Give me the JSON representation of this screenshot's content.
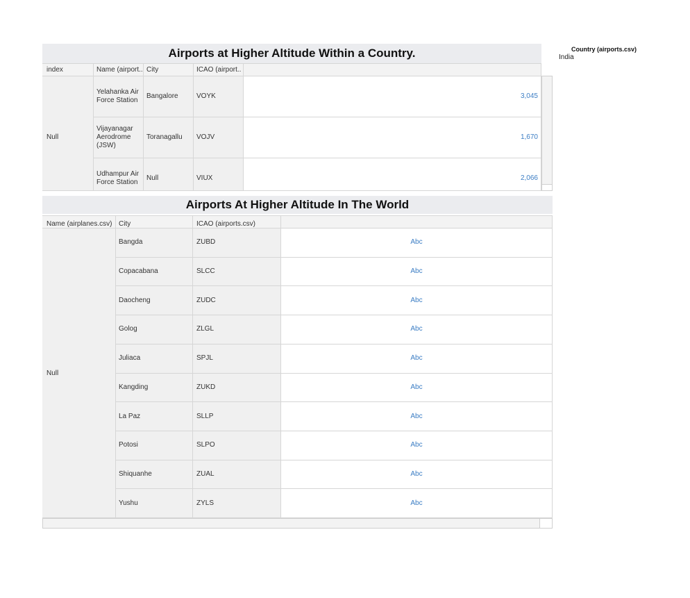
{
  "table1": {
    "title": "Airports at Higher Altitude Within a Country.",
    "headers": [
      "index",
      "Name (airport..",
      "City",
      "ICAO (airport.."
    ],
    "group": "Null",
    "rows": [
      {
        "name": "Yelahanka Air Force Station",
        "city": "Bangalore",
        "icao": "VOYK",
        "value": "3,045"
      },
      {
        "name": "Vijayanagar Aerodrome (JSW)",
        "city": "Toranagallu",
        "icao": "VOJV",
        "value": "1,670"
      },
      {
        "name": "Udhampur Air Force Station",
        "city": "Null",
        "icao": "VIUX",
        "value": "2,066"
      }
    ]
  },
  "table2": {
    "title": "Airports At Higher Altitude In The World",
    "headers": [
      "Name (airplanes.csv)",
      "City",
      "ICAO (airports.csv)"
    ],
    "group": "Null",
    "rows": [
      {
        "city": "Bangda",
        "icao": "ZUBD",
        "value": "Abc"
      },
      {
        "city": "Copacabana",
        "icao": "SLCC",
        "value": "Abc"
      },
      {
        "city": "Daocheng",
        "icao": "ZUDC",
        "value": "Abc"
      },
      {
        "city": "Golog",
        "icao": "ZLGL",
        "value": "Abc"
      },
      {
        "city": "Juliaca",
        "icao": "SPJL",
        "value": "Abc"
      },
      {
        "city": "Kangding",
        "icao": "ZUKD",
        "value": "Abc"
      },
      {
        "city": "La Paz",
        "icao": "SLLP",
        "value": "Abc"
      },
      {
        "city": "Potosi",
        "icao": "SLPO",
        "value": "Abc"
      },
      {
        "city": "Shiquanhe",
        "icao": "ZUAL",
        "value": "Abc"
      },
      {
        "city": "Yushu",
        "icao": "ZYLS",
        "value": "Abc"
      }
    ]
  },
  "filter": {
    "title": "Country (airports.csv)",
    "value": "India"
  },
  "colors": {
    "title_bg": "#ebecef",
    "measure_blue": "#3b7dc4",
    "dim_cell_bg": "#f0f0f0"
  }
}
